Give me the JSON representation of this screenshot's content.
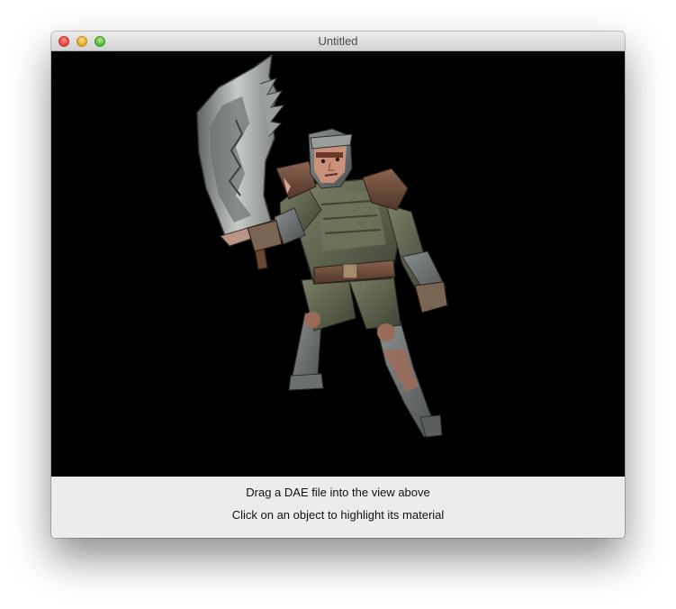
{
  "window": {
    "title": "Untitled"
  },
  "scene": {
    "subject": "knight-warrior-with-sword"
  },
  "instructions": {
    "line1": "Drag a DAE file into the view above",
    "line2": "Click on an object to highlight its material"
  },
  "colors": {
    "viewport_background": "#000000",
    "footer_background": "#ececec"
  }
}
